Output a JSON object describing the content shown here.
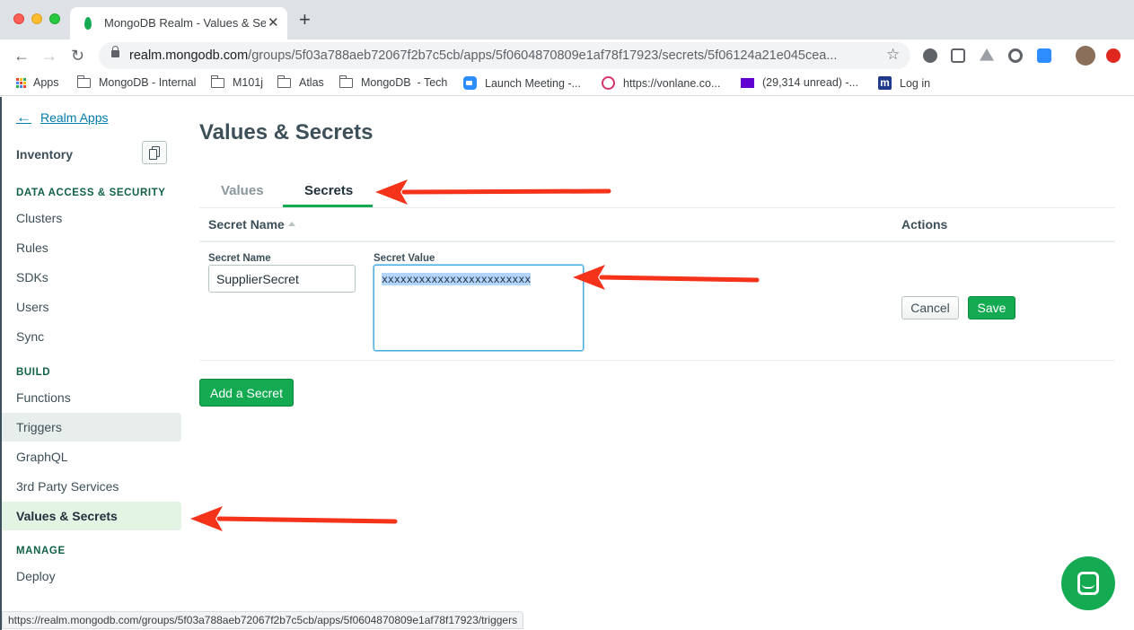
{
  "browser": {
    "tab_title": "MongoDB Realm - Values & Se",
    "url_host": "realm.mongodb.com",
    "url_path": "/groups/5f03a788aeb72067f2b7c5cb/apps/5f0604870809e1af78f17923/secrets/5f06124a21e045cea...",
    "bookmarks": [
      {
        "label": "Apps"
      },
      {
        "label": "MongoDB - Internal"
      },
      {
        "label": "M101j"
      },
      {
        "label": "Atlas"
      },
      {
        "label": "MongoDB  - Tech"
      },
      {
        "label": "Launch Meeting -..."
      },
      {
        "label": "https://vonlane.co..."
      },
      {
        "label": "(29,314 unread) -..."
      },
      {
        "label": "Log in"
      }
    ],
    "status_url": "https://realm.mongodb.com/groups/5f03a788aeb72067f2b7c5cb/apps/5f0604870809e1af78f17923/triggers"
  },
  "sidebar": {
    "back_label": "Realm Apps",
    "app_name": "Inventory",
    "sections": {
      "data_access": "DATA ACCESS & SECURITY",
      "build": "BUILD",
      "manage": "MANAGE"
    },
    "items": {
      "clusters": "Clusters",
      "rules": "Rules",
      "sdks": "SDKs",
      "users": "Users",
      "sync": "Sync",
      "functions": "Functions",
      "triggers": "Triggers",
      "graphql": "GraphQL",
      "third_party": "3rd Party Services",
      "values": "Values & Secrets",
      "deploy": "Deploy"
    }
  },
  "main": {
    "title": "Values & Secrets",
    "tabs": {
      "values": "Values",
      "secrets": "Secrets",
      "active": "Secrets"
    },
    "table": {
      "col_name": "Secret Name",
      "col_actions": "Actions"
    },
    "edit_row": {
      "name_label": "Secret Name",
      "name_value": "SupplierSecret",
      "value_label": "Secret Value",
      "value_value": "xxxxxxxxxxxxxxxxxxxxxxxx",
      "cancel_label": "Cancel",
      "save_label": "Save"
    },
    "add_button": "Add a Secret"
  },
  "colors": {
    "accent_green": "#13aa52",
    "annotation_red": "#f5321a",
    "link_blue": "#007cad"
  }
}
